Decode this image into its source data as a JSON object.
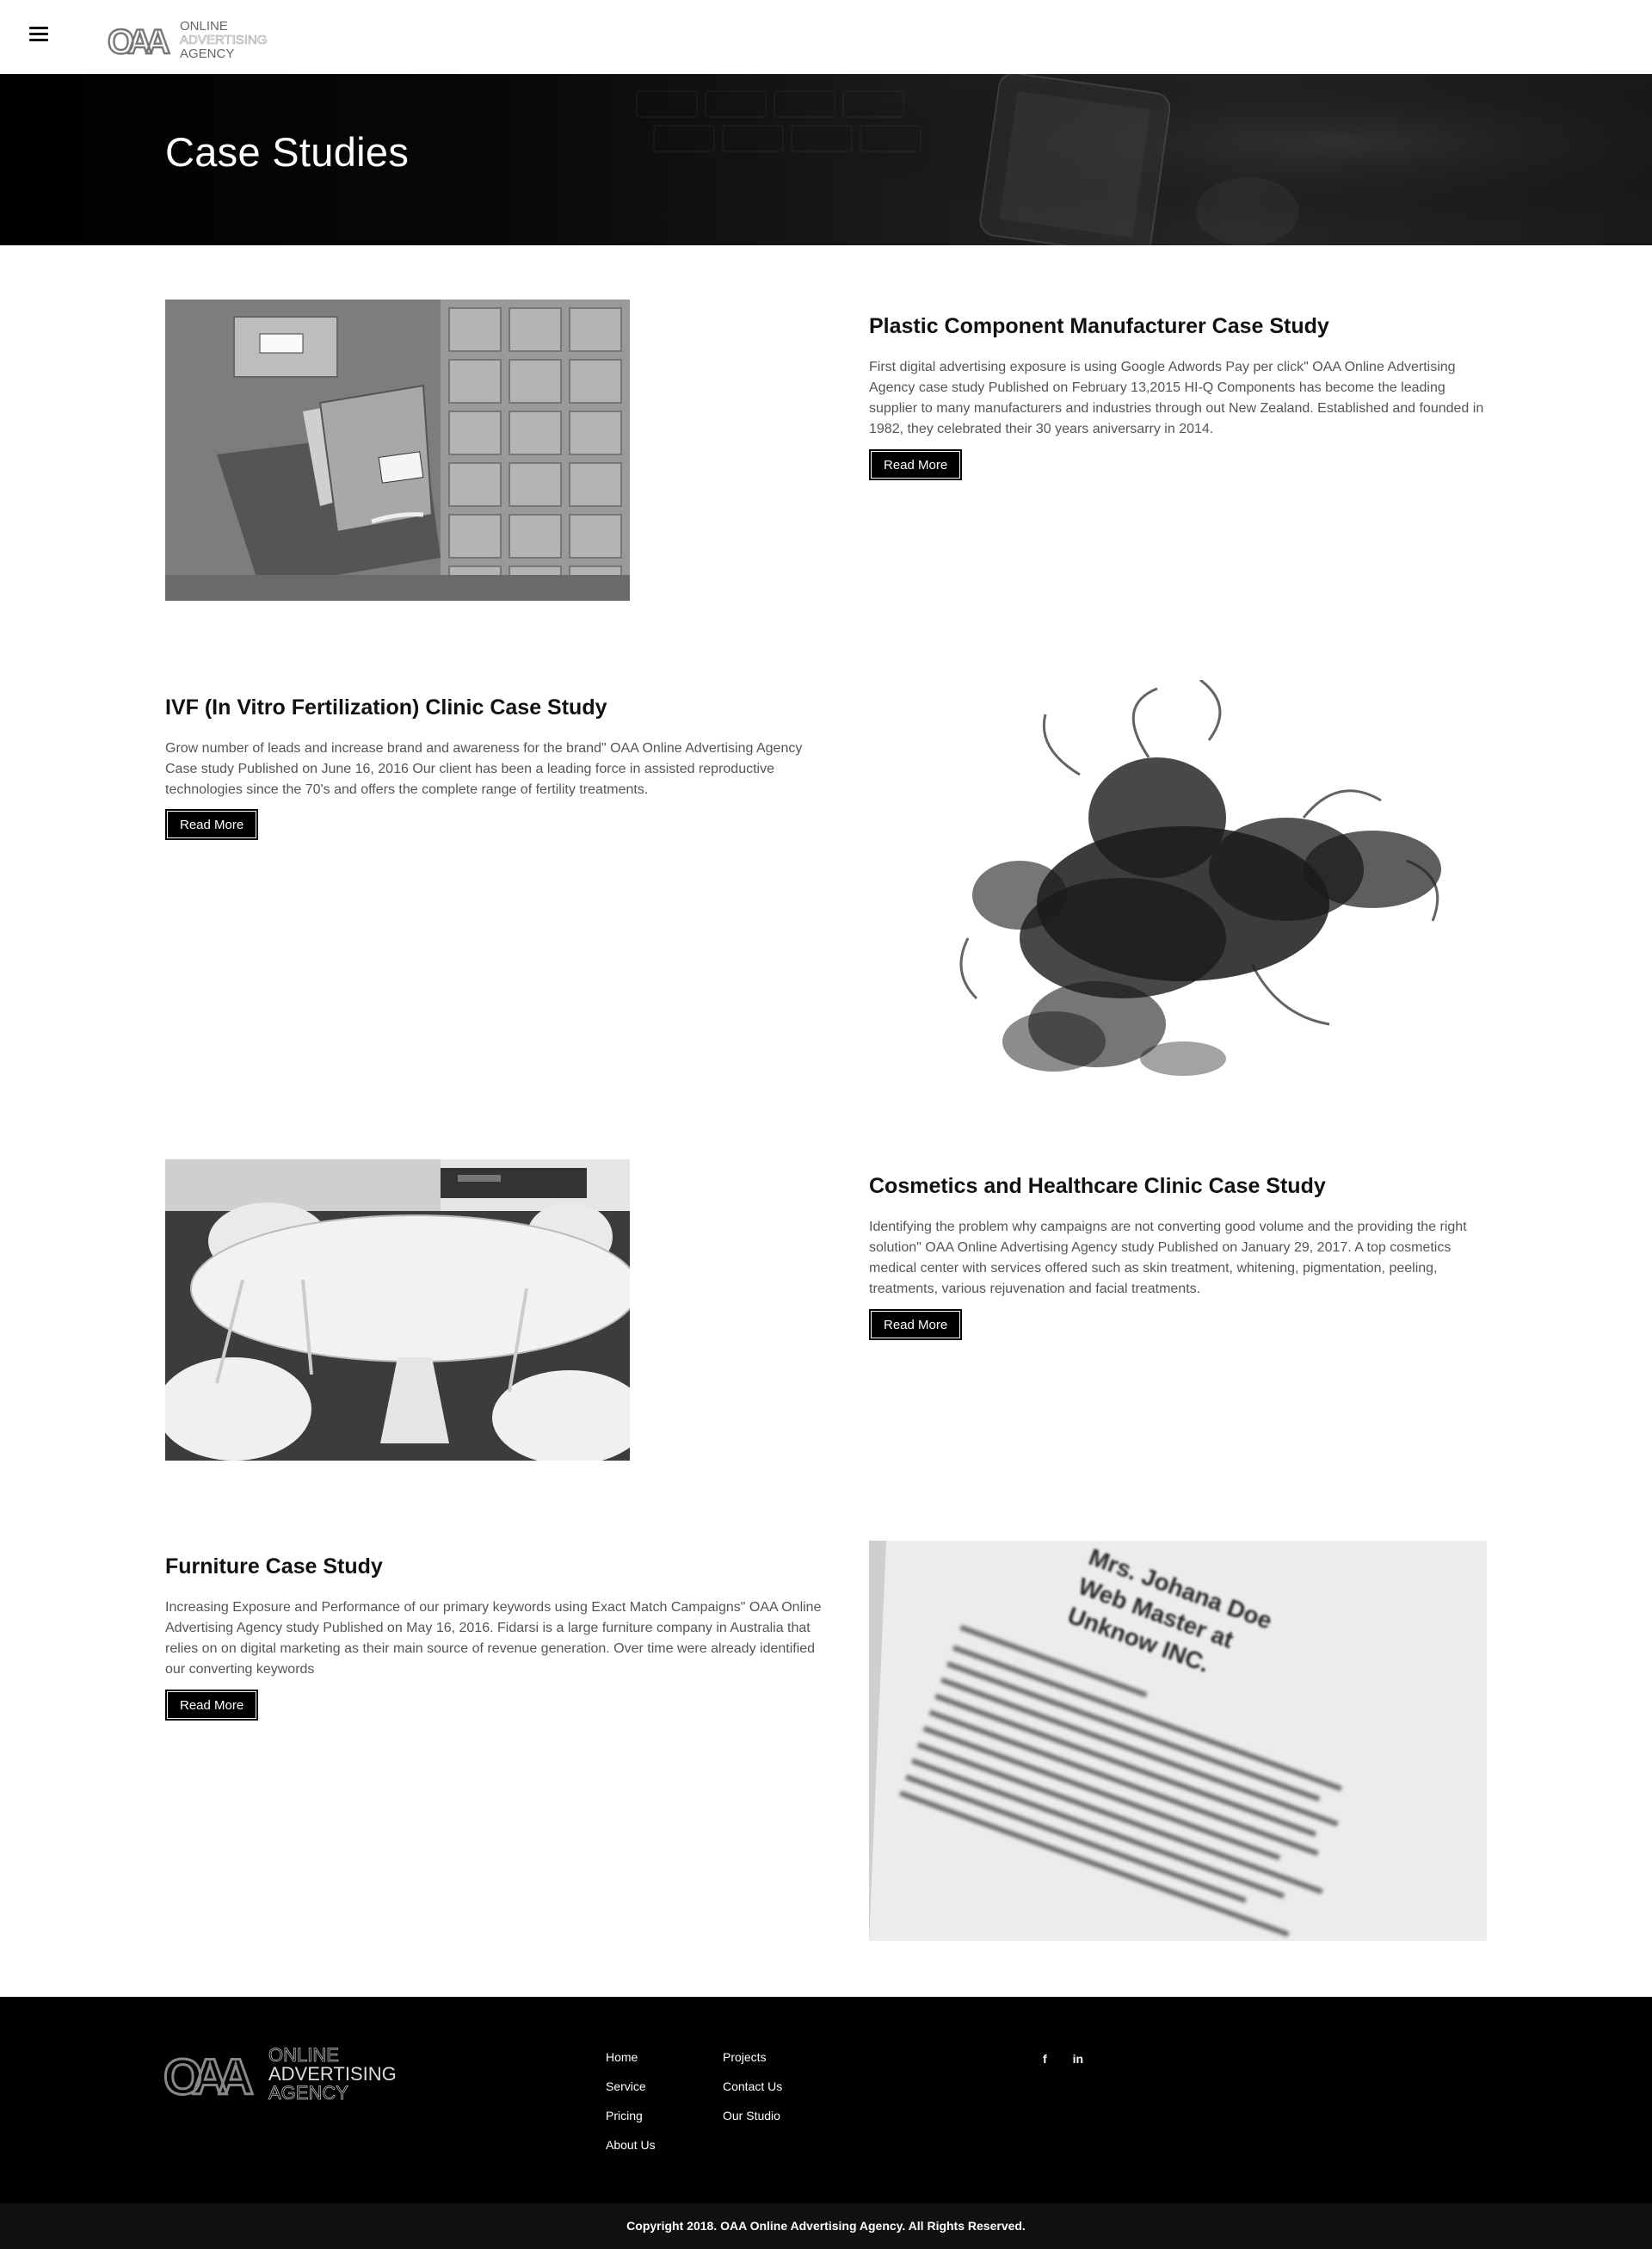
{
  "header": {
    "menu_icon": "hamburger-menu-icon",
    "logo": {
      "mark": "OAA",
      "line1": "ONLINE",
      "line2": "ADVERTISING",
      "line3": "AGENCY"
    }
  },
  "hero": {
    "title": "Case Studies"
  },
  "cases": [
    {
      "title": "Plastic Component Manufacturer Case Study",
      "description": "First digital advertising exposure is using Google Adwords Pay per click\" OAA Online Advertising Agency case study Published on February 13,2015 HI-Q Components has become the leading supplier to many manufacturers and industries through out New Zealand. Established and founded in 1982, they celebrated their 30 years aniversarry in 2014.",
      "button": "Read More"
    },
    {
      "title": "IVF (In Vitro Fertilization) Clinic Case Study",
      "description": "Grow number of leads and increase brand and awareness for the brand\" OAA Online Advertising Agency Case study Published on June 16, 2016 Our client has been a leading force in assisted reproductive technologies since the 70's and offers the complete range of fertility treatments.",
      "button": "Read More"
    },
    {
      "title": "Cosmetics and Healthcare Clinic Case Study",
      "description": "Identifying the problem why campaigns are not converting good volume and the providing the right solution\" OAA Online Advertising Agency study Published on January 29, 2017. A top cosmetics medical center with services offered such as skin treatment, whitening, pigmentation, peeling, treatments, various rejuvenation and facial treatments.",
      "button": "Read More"
    },
    {
      "title": "Furniture Case Study",
      "description": "Increasing Exposure and Performance of our primary keywords using Exact Match Campaigns\" OAA Online Advertising Agency study Published on May 16, 2016. Fidarsi is a large furniture company in Australia that relies on on digital marketing as their main source of revenue generation. Over time were already identified our converting keywords",
      "button": "Read More",
      "image_text": {
        "line1": "Mrs. Johana Doe",
        "line2": "Web Master at",
        "line3": "Unknow INC."
      }
    }
  ],
  "footer": {
    "logo": {
      "mark": "OAA",
      "line1": "ONLINE",
      "line2": "ADVERTISING",
      "line3": "AGENCY"
    },
    "col1": [
      "Home",
      "Service",
      "Pricing",
      "About Us"
    ],
    "col2": [
      "Projects",
      "Contact Us",
      "Our Studio"
    ],
    "social": {
      "facebook": "f",
      "linkedin": "in"
    },
    "copyright": "Copyright 2018. OAA Online Advertising Agency. All Rights Reserved."
  },
  "colors": {
    "background": "#ffffff",
    "dark": "#000000",
    "text": "#111111",
    "muted": "#555555"
  }
}
